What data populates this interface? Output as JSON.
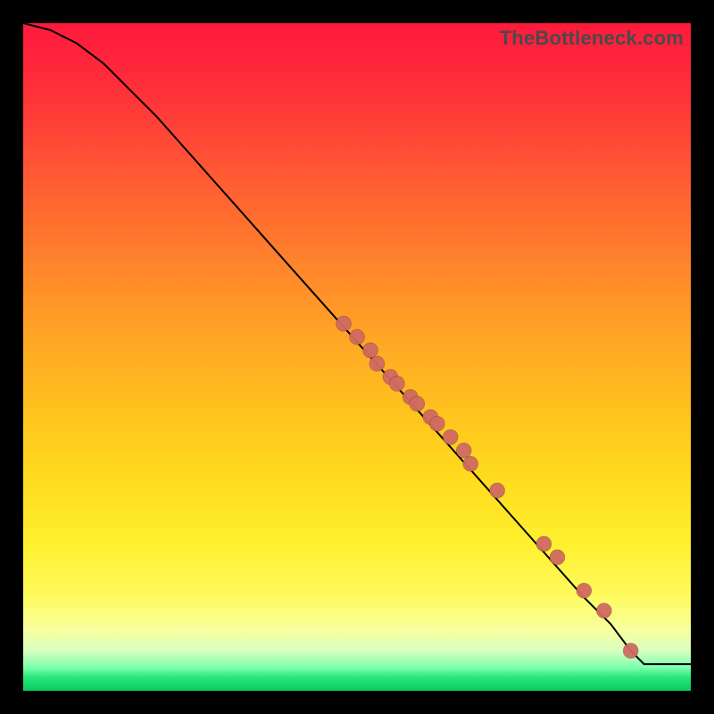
{
  "watermark": "TheBottleneck.com",
  "colors": {
    "dot": "#d16a62",
    "curve": "#000000",
    "frame": "#000000"
  },
  "chart_data": {
    "type": "line",
    "title": "",
    "xlabel": "",
    "ylabel": "",
    "xlim": [
      0,
      100
    ],
    "ylim": [
      0,
      100
    ],
    "grid": false,
    "legend": false,
    "annotations": [
      "TheBottleneck.com"
    ],
    "series": [
      {
        "name": "curve",
        "kind": "line",
        "x": [
          0,
          4,
          8,
          12,
          16,
          20,
          28,
          36,
          44,
          52,
          60,
          68,
          76,
          84,
          88,
          91,
          93,
          96,
          100
        ],
        "y": [
          100,
          99,
          97,
          94,
          90,
          86,
          77,
          68,
          59,
          50,
          41,
          32,
          23,
          14,
          10,
          6,
          4,
          4,
          4
        ]
      },
      {
        "name": "markers",
        "kind": "scatter",
        "x": [
          48,
          50,
          52,
          53,
          55,
          56,
          58,
          59,
          61,
          62,
          64,
          66,
          67,
          71,
          78,
          80,
          84,
          87,
          91
        ],
        "y": [
          55,
          53,
          51,
          49,
          47,
          46,
          44,
          43,
          41,
          40,
          38,
          36,
          34,
          30,
          22,
          20,
          15,
          12,
          6
        ]
      }
    ]
  }
}
